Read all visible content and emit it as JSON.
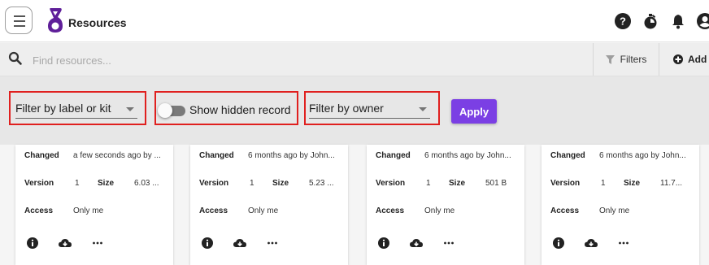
{
  "header": {
    "title": "Resources",
    "icons": [
      "menu-icon",
      "logo-icon",
      "help-icon",
      "timer-icon",
      "bell-icon",
      "account-icon"
    ]
  },
  "search": {
    "placeholder": "Find resources...",
    "filters_label": "Filters",
    "add_label": "Add"
  },
  "filters": {
    "label_kit_value": "Filter by label or kit",
    "show_hidden_label": "Show hidden record",
    "show_hidden_checked": false,
    "owner_value": "Filter by owner",
    "apply_label": "Apply",
    "apply_color": "#7b3fe4",
    "highlight_color": "#e0201f"
  },
  "card_labels": {
    "changed": "Changed",
    "version": "Version",
    "size": "Size",
    "access": "Access"
  },
  "cards": [
    {
      "changed": "a few seconds ago by ...",
      "version": "1",
      "size": "6.03 ...",
      "access": "Only me"
    },
    {
      "changed": "6 months ago by John...",
      "version": "1",
      "size": "5.23 ...",
      "access": "Only me"
    },
    {
      "changed": "6 months ago by John...",
      "version": "1",
      "size": "501 B",
      "access": "Only me"
    },
    {
      "changed": "6 months ago by John...",
      "version": "1",
      "size": "11.7...",
      "access": "Only me"
    }
  ],
  "card_actions": [
    "info-icon",
    "cloud-download-icon",
    "more-icon"
  ]
}
